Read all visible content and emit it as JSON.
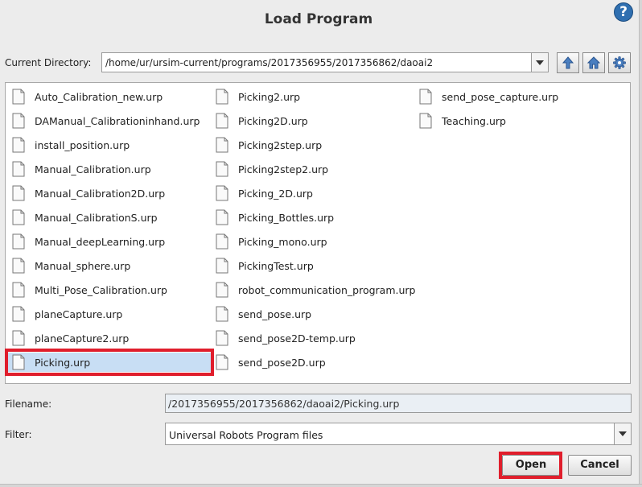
{
  "dialog": {
    "title": "Load Program",
    "help": "?"
  },
  "directory": {
    "label": "Current Directory:",
    "path": "/home/ur/ursim-current/programs/2017356955/2017356862/daoai2"
  },
  "toolbar": {
    "up_icon": "arrow-up-icon",
    "home_icon": "home-icon",
    "settings_icon": "gear-icon"
  },
  "files": {
    "col1": [
      "Auto_Calibration_new.urp",
      "DAManual_Calibrationinhand.urp",
      "install_position.urp",
      "Manual_Calibration.urp",
      "Manual_Calibration2D.urp",
      "Manual_CalibrationS.urp",
      "Manual_deepLearning.urp",
      "Manual_sphere.urp",
      "Multi_Pose_Calibration.urp",
      "planeCapture.urp",
      "planeCapture2.urp",
      "Picking.urp"
    ],
    "col2": [
      "Picking2.urp",
      "Picking2D.urp",
      "Picking2step.urp",
      "Picking2step2.urp",
      "Picking_2D.urp",
      "Picking_Bottles.urp",
      "Picking_mono.urp",
      "PickingTest.urp",
      "robot_communication_program.urp",
      "send_pose.urp",
      "send_pose2D-temp.urp",
      "send_pose2D.urp"
    ],
    "col3": [
      "send_pose_capture.urp",
      "Teaching.urp"
    ],
    "selected": "Picking.urp"
  },
  "filename": {
    "label": "Filename:",
    "value": "/2017356955/2017356862/daoai2/Picking.urp"
  },
  "filter": {
    "label": "Filter:",
    "value": "Universal Robots Program files"
  },
  "buttons": {
    "open": "Open",
    "cancel": "Cancel"
  },
  "colors": {
    "highlight": "#e01e2c",
    "selection": "#c8def4",
    "help_blue": "#2f6fb0"
  }
}
